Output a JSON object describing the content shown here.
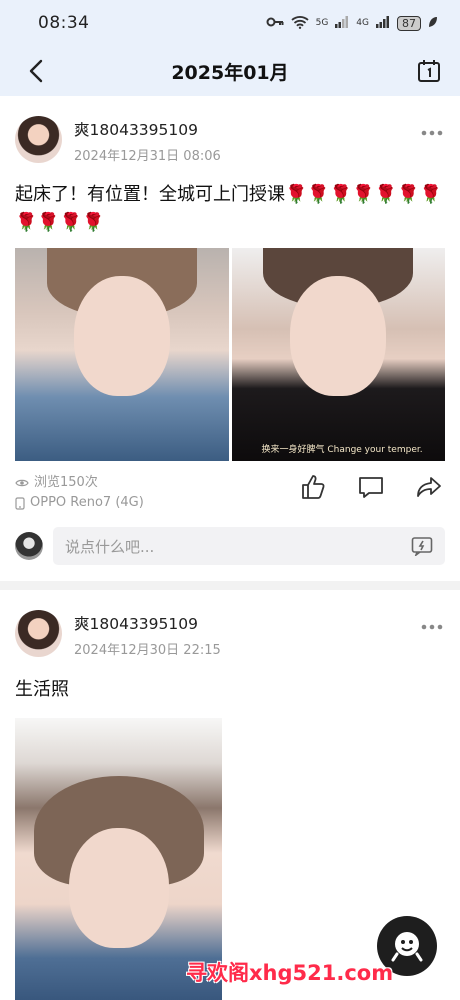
{
  "status_bar": {
    "time": "08:34",
    "battery": "87",
    "signal_5g": "5G",
    "signal_4g": "4G"
  },
  "header": {
    "title": "2025年01月"
  },
  "posts": [
    {
      "username": "爽18043395109",
      "time": "2024年12月31日 08:06",
      "text": "起床了！有位置！全城可上门授课🌹🌹🌹🌹🌹🌹🌹🌹🌹🌹🌹",
      "photo_caption": "换来一身好脾气 Change your temper.",
      "views": "浏览150次",
      "device": "OPPO Reno7 (4G)",
      "comment_placeholder": "说点什么吧..."
    },
    {
      "username": "爽18043395109",
      "time": "2024年12月30日 22:15",
      "text": "生活照"
    }
  ],
  "watermark": "寻欢阁xhg521.com",
  "icons": [
    "back-icon",
    "calendar-icon",
    "more-icon",
    "eye-icon",
    "phone-icon",
    "like-icon",
    "comment-icon",
    "share-icon",
    "emoji-icon",
    "assistant-icon"
  ]
}
